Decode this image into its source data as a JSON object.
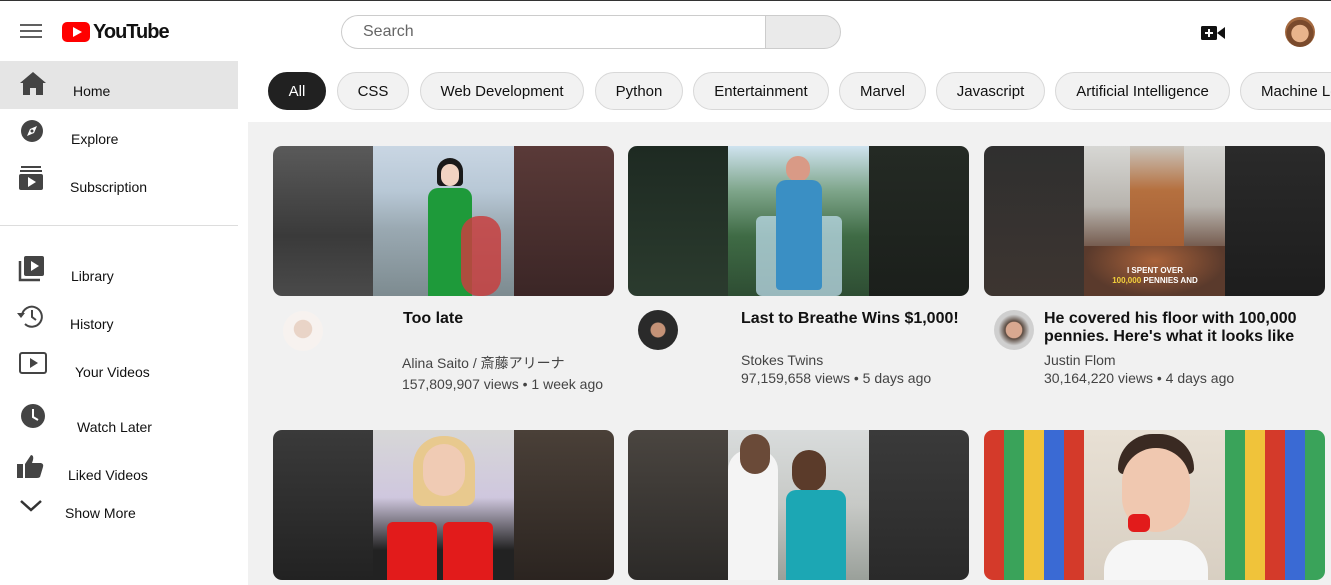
{
  "header": {
    "logo_text": "YouTube",
    "search_placeholder": "Search"
  },
  "sidebar": {
    "items": [
      {
        "label": "Home",
        "icon": "home-icon"
      },
      {
        "label": "Explore",
        "icon": "compass-icon"
      },
      {
        "label": "Subscription",
        "icon": "subscriptions-icon"
      },
      {
        "label": "Library",
        "icon": "library-icon"
      },
      {
        "label": "History",
        "icon": "history-icon"
      },
      {
        "label": "Your Videos",
        "icon": "your-videos-icon"
      },
      {
        "label": "Watch Later",
        "icon": "clock-icon"
      },
      {
        "label": "Liked Videos",
        "icon": "thumbs-up-icon"
      },
      {
        "label": "Show More",
        "icon": "chevron-down-icon"
      }
    ]
  },
  "chips": [
    "All",
    "CSS",
    "Web Development",
    "Python",
    "Entertainment",
    "Marvel",
    "Javascript",
    "Artificial Intelligence",
    "Machine Learning"
  ],
  "videos": [
    {
      "title": "Too late",
      "channel": "Alina Saito / 斎藤アリーナ",
      "stats": "157,809,907 views • 1 week ago"
    },
    {
      "title": "Last to Breathe Wins $1,000!",
      "channel": "Stokes Twins",
      "stats": "97,159,658 views • 5 days ago"
    },
    {
      "title": "He covered his floor with 100,000 pennies. Here's what it looks like",
      "channel": "Justin Flom",
      "stats": "30,164,220 views • 4 days ago"
    }
  ],
  "thumbnail_caption": {
    "line1": "I SPENT OVER",
    "line2_highlight": "100,000",
    "line2_rest": "PENNIES AND"
  },
  "colors": {
    "brand_red": "#ff0000",
    "chip_active": "#212121"
  }
}
